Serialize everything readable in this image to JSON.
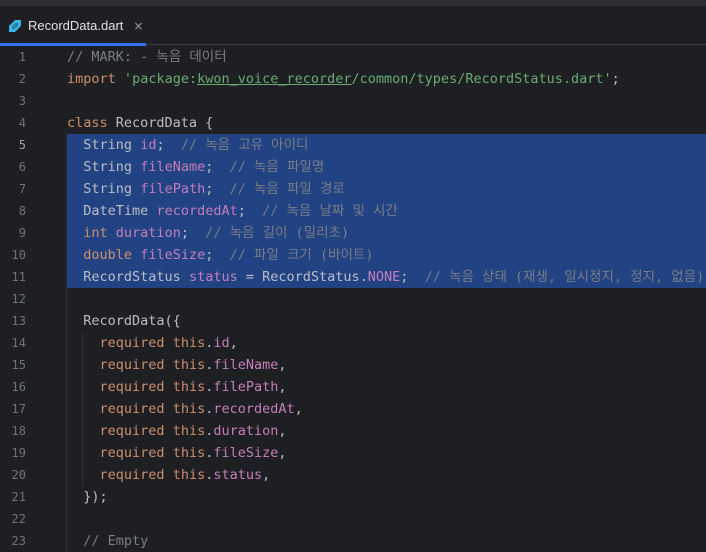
{
  "tab": {
    "icon": "dart-icon",
    "label": "RecordData.dart",
    "close": "×"
  },
  "gutter": {
    "line_numbers": [
      "1",
      "2",
      "3",
      "4",
      "5",
      "6",
      "7",
      "8",
      "9",
      "10",
      "11",
      "12",
      "13",
      "14",
      "15",
      "16",
      "17",
      "18",
      "19",
      "20",
      "21",
      "22",
      "23"
    ],
    "current_line": "5"
  },
  "code": {
    "l1": {
      "comment": "// MARK: - 녹음 데이터"
    },
    "l2": {
      "import_kw": "import",
      "q1": "'",
      "pkg": "package:",
      "under": "kwon_voice_recorder",
      "path": "/common/types/RecordStatus.dart",
      "q2": "'",
      "semi": ";"
    },
    "l4": {
      "class_kw": "class",
      "name": " RecordData {"
    },
    "l5": {
      "type": "String",
      "field": "id",
      "semi": ";",
      "comment": "// 녹음 고유 아이디"
    },
    "l6": {
      "type": "String",
      "field": "fileName",
      "semi": ";",
      "comment": "// 녹음 파일명"
    },
    "l7": {
      "type": "String",
      "field": "filePath",
      "semi": ";",
      "comment": "// 녹음 파일 경로"
    },
    "l8": {
      "type": "DateTime",
      "field": "recordedAt",
      "semi": ";",
      "comment": "// 녹음 날짜 및 시간"
    },
    "l9": {
      "type": "int",
      "field": "duration",
      "semi": ";",
      "comment": "// 녹음 길이 (밀리초)"
    },
    "l10": {
      "type": "double",
      "field": "fileSize",
      "semi": ";",
      "comment": "// 파일 크기 (바이트)"
    },
    "l11": {
      "type": "RecordStatus",
      "field": "status",
      "assign": " = RecordStatus.",
      "enumv": "NONE",
      "semi": ";",
      "comment": "// 녹음 상태 (재생, 일시정지, 정지, 없음)"
    },
    "l13": {
      "text": "RecordData({"
    },
    "params": [
      {
        "req": "required",
        "this": "this",
        "field": "id"
      },
      {
        "req": "required",
        "this": "this",
        "field": "fileName"
      },
      {
        "req": "required",
        "this": "this",
        "field": "filePath"
      },
      {
        "req": "required",
        "this": "this",
        "field": "recordedAt"
      },
      {
        "req": "required",
        "this": "this",
        "field": "duration"
      },
      {
        "req": "required",
        "this": "this",
        "field": "fileSize"
      },
      {
        "req": "required",
        "this": "this",
        "field": "status"
      }
    ],
    "l21": {
      "text": "});"
    },
    "l23": {
      "comment": "// Empty"
    }
  },
  "colors": {
    "background": "#1e1f22",
    "selection": "#214283",
    "keyword": "#cf8e6d",
    "comment": "#7a7e85",
    "string": "#6aab73",
    "field": "#c77dbb",
    "text": "#bcbec4",
    "tab_accent": "#3574f0"
  }
}
